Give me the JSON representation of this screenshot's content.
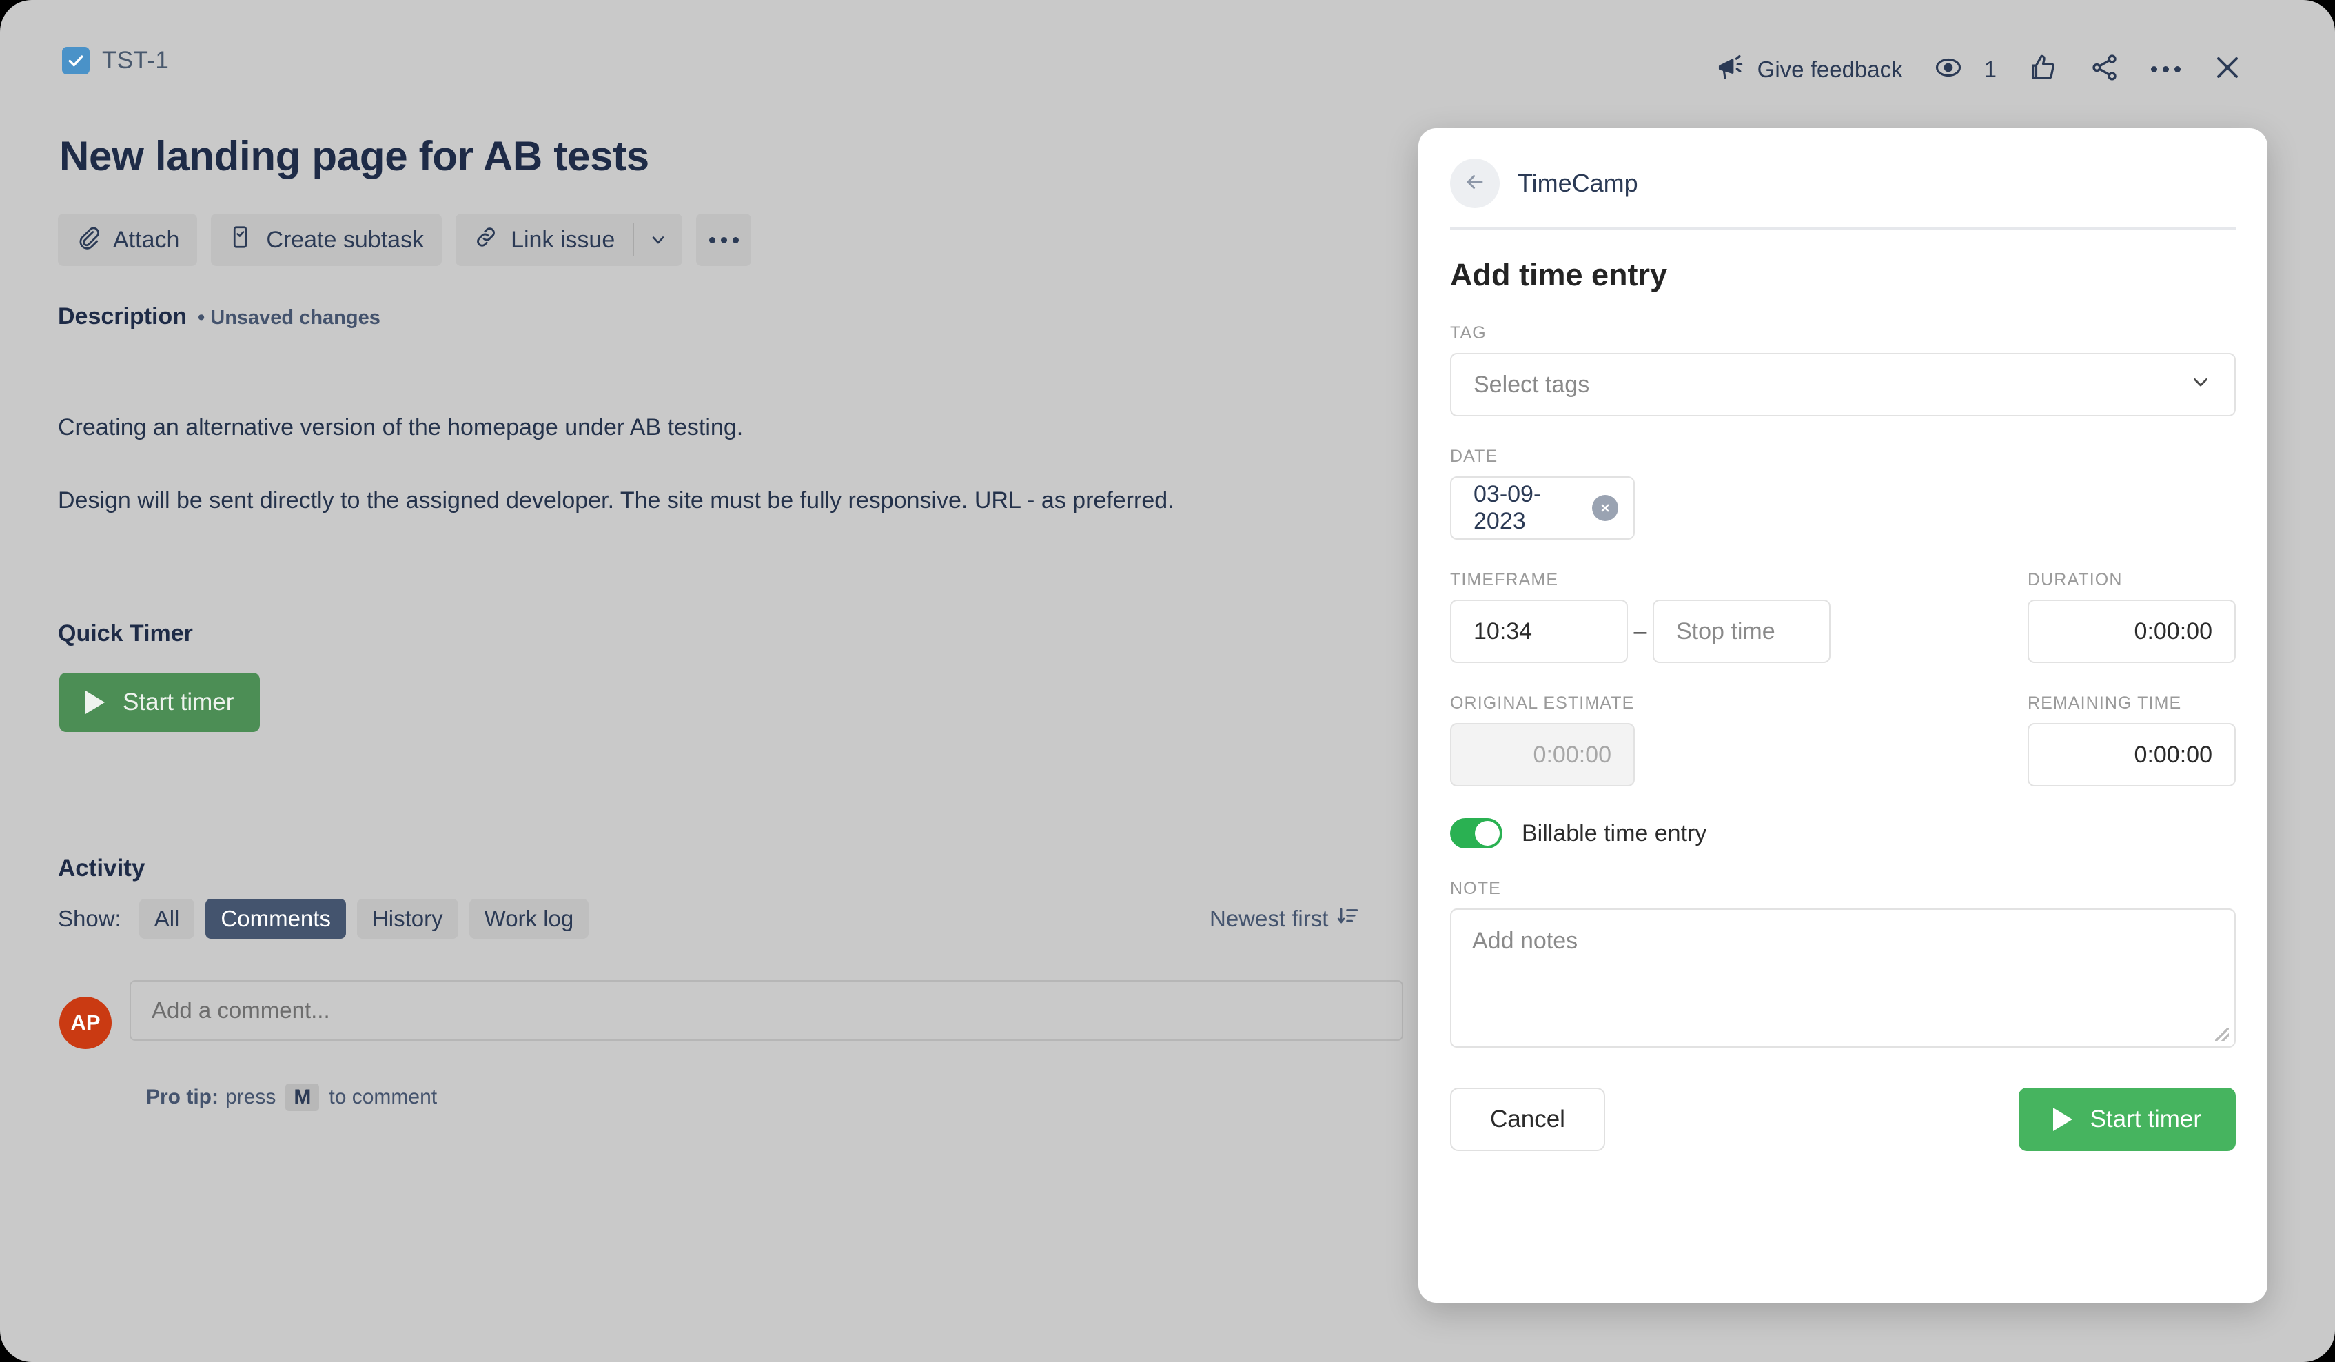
{
  "issue": {
    "key": "TST-1",
    "title": "New landing page for AB tests",
    "checkbox_icon": "task-check-icon",
    "toolbar": {
      "attach_label": "Attach",
      "create_subtask_label": "Create subtask",
      "link_issue_label": "Link issue",
      "chevron_icon": "chevron-down-icon",
      "more_icon": "ellipsis-icon"
    },
    "header_actions": {
      "give_feedback_label": "Give feedback",
      "feedback_icon": "megaphone-icon",
      "watch_icon": "eye-icon",
      "watch_count": "1",
      "like_icon": "thumbs-up-icon",
      "share_icon": "share-icon",
      "more_icon": "ellipsis-icon",
      "close_icon": "close-icon"
    },
    "description": {
      "label": "Description",
      "status": "• Unsaved changes",
      "paragraphs": [
        "Creating an alternative version of the homepage under AB testing.",
        "Design will be sent directly to the assigned developer. The site must be fully responsive. URL - as preferred."
      ]
    },
    "quick_timer": {
      "label": "Quick Timer",
      "button_label": "Start timer",
      "play_icon": "play-icon"
    },
    "activity": {
      "label": "Activity",
      "show_label": "Show:",
      "filters": [
        {
          "label": "All",
          "active": false
        },
        {
          "label": "Comments",
          "active": true
        },
        {
          "label": "History",
          "active": false
        },
        {
          "label": "Work log",
          "active": false
        }
      ],
      "sort_label": "Newest first",
      "sort_icon": "sort-descending-icon",
      "avatar_initials": "AP",
      "comment_placeholder": "Add a comment...",
      "pro_tip_prefix": "Pro tip:",
      "pro_tip_mid": "press",
      "pro_tip_key": "M",
      "pro_tip_suffix": "to comment"
    }
  },
  "panel": {
    "app_name": "TimeCamp",
    "back_icon": "arrow-left-icon",
    "title": "Add time entry",
    "tag": {
      "label": "TAG",
      "placeholder": "Select tags",
      "chevron_icon": "chevron-down-icon"
    },
    "date": {
      "label": "DATE",
      "value": "03-09-2023",
      "clear_icon": "clear-circle-icon"
    },
    "timeframe": {
      "label": "TIMEFRAME",
      "start_value": "10:34",
      "separator": "–",
      "stop_placeholder": "Stop time"
    },
    "duration": {
      "label": "DURATION",
      "value": "0:00:00"
    },
    "original_estimate": {
      "label": "ORIGINAL ESTIMATE",
      "value": "0:00:00"
    },
    "remaining_time": {
      "label": "REMAINING TIME",
      "value": "0:00:00"
    },
    "billable": {
      "label": "Billable time entry",
      "enabled": true
    },
    "note": {
      "label": "NOTE",
      "placeholder": "Add notes"
    },
    "footer": {
      "cancel_label": "Cancel",
      "start_label": "Start timer",
      "play_icon": "play-icon"
    }
  },
  "colors": {
    "page_bg": "#c9c9c9",
    "accent_blue": "#4a92c8",
    "green_primary": "#46b45f",
    "green_quick": "#4c8e55",
    "toggle_green": "#2ab152",
    "avatar_red": "#ca3a12",
    "chip_active": "#44546e",
    "text_dark": "#1e2b47"
  }
}
